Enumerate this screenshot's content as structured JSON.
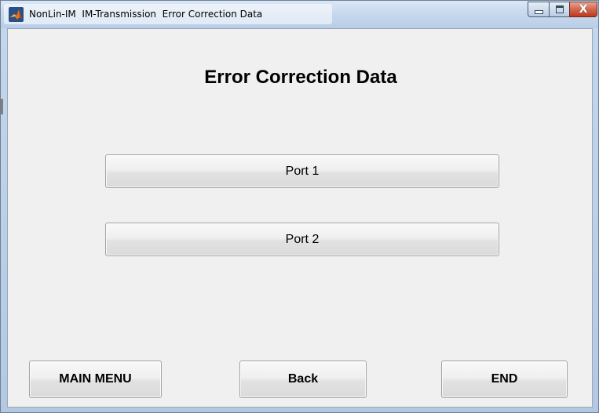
{
  "window": {
    "title": "NonLin-IM  IM-Transmission  Error Correction Data",
    "buttons": {
      "minimize": "–",
      "maximize": "□",
      "close": "X"
    }
  },
  "content": {
    "heading": "Error Correction Data",
    "port_buttons": [
      "Port 1",
      "Port 2"
    ],
    "nav_buttons": {
      "main_menu": "MAIN MENU",
      "back": "Back",
      "end": "END"
    }
  },
  "icons": {
    "app": "matlab-icon"
  },
  "colors": {
    "titlebar": "#c6d8ee",
    "client_bg": "#f0f0f0",
    "close_button": "#c0391d"
  }
}
